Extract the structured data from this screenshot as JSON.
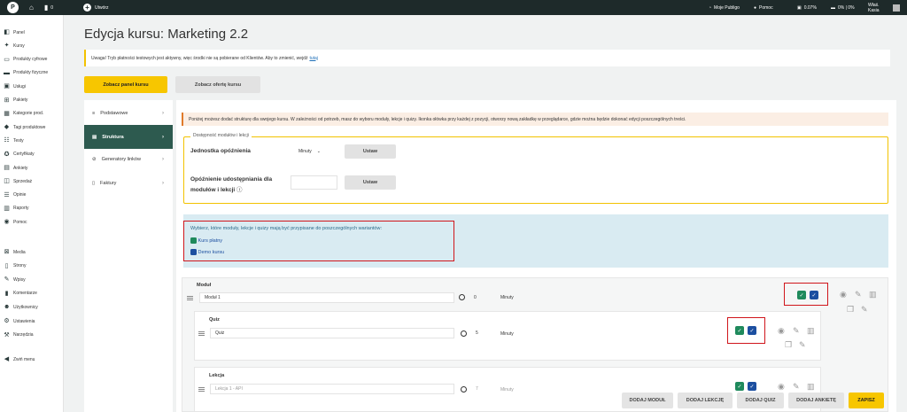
{
  "topbar": {
    "notifications_count": "0",
    "create_label": "Utwórz",
    "links": [
      "Moje Publigo",
      "Pomoc"
    ],
    "storage": "0.07%",
    "transfer": "0% | 0%",
    "user": "Właś. Kasia"
  },
  "sidebar": {
    "group1": [
      {
        "label": "Panel",
        "icon": "dashboard-icon"
      },
      {
        "label": "Kursy",
        "icon": "courses-icon"
      },
      {
        "label": "Produkty cyfrowe",
        "icon": "digital-products-icon"
      },
      {
        "label": "Produkty fizyczne",
        "icon": "physical-products-icon"
      },
      {
        "label": "Usługi",
        "icon": "services-icon"
      },
      {
        "label": "Pakiety",
        "icon": "bundles-icon"
      },
      {
        "label": "Kategorie prod.",
        "icon": "categories-icon"
      },
      {
        "label": "Tagi produktowe",
        "icon": "tags-icon"
      },
      {
        "label": "Testy",
        "icon": "tests-icon"
      },
      {
        "label": "Certyfikaty",
        "icon": "certificates-icon"
      },
      {
        "label": "Ankiety",
        "icon": "surveys-icon"
      },
      {
        "label": "Sprzedaż",
        "icon": "sales-icon"
      },
      {
        "label": "Opinie",
        "icon": "reviews-icon"
      },
      {
        "label": "Raporty",
        "icon": "reports-icon"
      },
      {
        "label": "Pomoc",
        "icon": "help-icon"
      }
    ],
    "group2": [
      {
        "label": "Media",
        "icon": "media-icon"
      },
      {
        "label": "Strony",
        "icon": "pages-icon"
      },
      {
        "label": "Wpisy",
        "icon": "posts-icon"
      },
      {
        "label": "Komentarze",
        "icon": "comments-icon"
      },
      {
        "label": "Użytkownicy",
        "icon": "users-icon"
      },
      {
        "label": "Ustawienia",
        "icon": "settings-icon"
      },
      {
        "label": "Narzędzia",
        "icon": "tools-icon"
      }
    ],
    "collapse_label": "Zwiń menu"
  },
  "page": {
    "title": "Edycja kursu: Marketing 2.2",
    "warning_text": "Uwaga! Tryb płatności testowych jest aktywny, więc środki nie są pobierane od Klientów. Aby to zmienić, wejdź",
    "warning_link": "tutaj",
    "btn_panel": "Zobacz panel kursu",
    "btn_offer": "Zobacz ofertę kursu"
  },
  "leftnav": [
    {
      "label": "Podstawowe",
      "icon": "settings-sliders-icon"
    },
    {
      "label": "Struktura",
      "icon": "structure-icon",
      "active": true
    },
    {
      "label": "Generatory linków",
      "icon": "link-icon"
    },
    {
      "label": "Faktury",
      "icon": "invoice-icon"
    }
  ],
  "structure": {
    "info_text": "Poniżej możesz dodać strukturę dla swojego kursu. W zależności od potrzeb, masz do wyboru moduły, lekcje i quizy. Ikonka ołówka przy każdej z pozycji, otworzy nową zakładkę w przeglądarce, gdzie można będzie dokonać edycji poszczególnych treści.",
    "fieldset_legend": "Dostępność modułów i lekcji",
    "delay_unit_label": "Jednostka opóźnienia",
    "delay_unit_value": "Minuty",
    "set_label": "Ustaw",
    "delay_label_line1": "Opóźnienie udostępniania dla",
    "delay_label_line2": "modułów i lekcji",
    "variants_title": "Wybierz, które moduły, lekcje i quizy mają być przypisane do poszczególnych wariantów:",
    "variants": [
      {
        "name": "Kurs płatny",
        "color": "#1f8a5c"
      },
      {
        "name": "Demo kursu",
        "color": "#1c4fa0"
      }
    ]
  },
  "items": {
    "module": {
      "type": "Moduł",
      "name": "Moduł 1",
      "delay": "0",
      "unit": "Minuty"
    },
    "quiz": {
      "type": "Quiz",
      "name": "Quiz",
      "delay": "5",
      "unit": "Minuty"
    },
    "lesson": {
      "type": "Lekcja",
      "name": "Lekcja 1 - API",
      "delay": "7",
      "unit": "Minuty"
    }
  },
  "bottom": {
    "add_module": "DODAJ MODUŁ",
    "add_lesson": "DODAJ LEKCJĘ",
    "add_quiz": "DODAJ QUIZ",
    "add_survey": "DODAJ ANKIETĘ",
    "save": "ZAPISZ"
  },
  "colors": {
    "accent": "#f7c600",
    "active_nav": "#2d5a4f",
    "paid_variant": "#1f8a5c",
    "demo_variant": "#1c4fa0",
    "highlight": "#d0151b"
  }
}
